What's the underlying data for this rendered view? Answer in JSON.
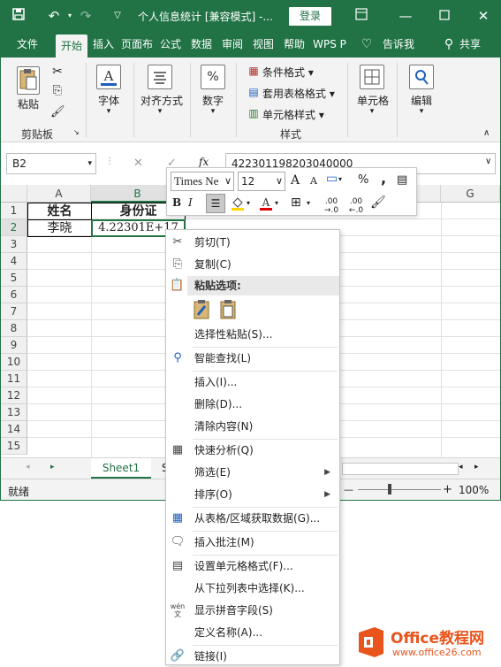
{
  "titlebar": {
    "title": "个人信息统计  [兼容模式]  -...",
    "login": "登录"
  },
  "tabs": [
    "文件",
    "开始",
    "插入",
    "页面布",
    "公式",
    "数据",
    "审阅",
    "视图",
    "帮助",
    "WPS P",
    "告诉我",
    "共享"
  ],
  "ribbon": {
    "clipboard": {
      "paste": "粘贴",
      "label": "剪贴板"
    },
    "font": {
      "label": "字体"
    },
    "align": {
      "label": "对齐方式"
    },
    "number": {
      "label": "数字"
    },
    "styles": {
      "cond": "条件格式",
      "table": "套用表格格式",
      "cell": "单元格样式",
      "label": "样式"
    },
    "cells": {
      "label": "单元格"
    },
    "edit": {
      "label": "编辑"
    }
  },
  "formula_bar": {
    "namebox": "B2",
    "fx": "fx",
    "formula": "422301198203040000"
  },
  "grid": {
    "columns": [
      "A",
      "B",
      "G"
    ],
    "rows": [
      "1",
      "2",
      "3",
      "4",
      "5",
      "6",
      "7",
      "8",
      "9",
      "10",
      "11",
      "12",
      "13",
      "14",
      "15"
    ],
    "cells": {
      "a1": "姓名",
      "b1": "身份证",
      "a2": "李晓",
      "b2": "4.22301E+17"
    }
  },
  "sheet": {
    "tab": "Sheet1",
    "partial": "S"
  },
  "status": {
    "ready": "就绪",
    "zoom": "100%"
  },
  "minibar": {
    "font": "Times Ne",
    "size": "12",
    "bold": "B",
    "italic": "I",
    "pct": "%",
    "comma": ",",
    "dec_inc": ".00 →.0",
    "dec_dec": ".00 ←.0",
    "grow": "A",
    "shrink": "A"
  },
  "menu": {
    "cut": "剪切(T)",
    "copy": "复制(C)",
    "paste_header": "粘贴选项:",
    "paste_special": "选择性粘贴(S)...",
    "smart_lookup": "智能查找(L)",
    "insert": "插入(I)...",
    "delete": "删除(D)...",
    "clear": "清除内容(N)",
    "quick_analysis": "快速分析(Q)",
    "filter": "筛选(E)",
    "sort": "排序(O)",
    "get_data": "从表格/区域获取数据(G)...",
    "insert_comment": "插入批注(M)",
    "format_cells": "设置单元格格式(F)...",
    "pick_list": "从下拉列表中选择(K)...",
    "phonetic": "显示拼音字段(S)",
    "define_name": "定义名称(A)...",
    "link": "链接(I)",
    "phonetic_icon": "wén 文"
  },
  "watermark": {
    "brand": "Office教程网",
    "url": "www.office26.com"
  },
  "colors": {
    "accent": "#217346",
    "watermark": "#e8541c"
  }
}
